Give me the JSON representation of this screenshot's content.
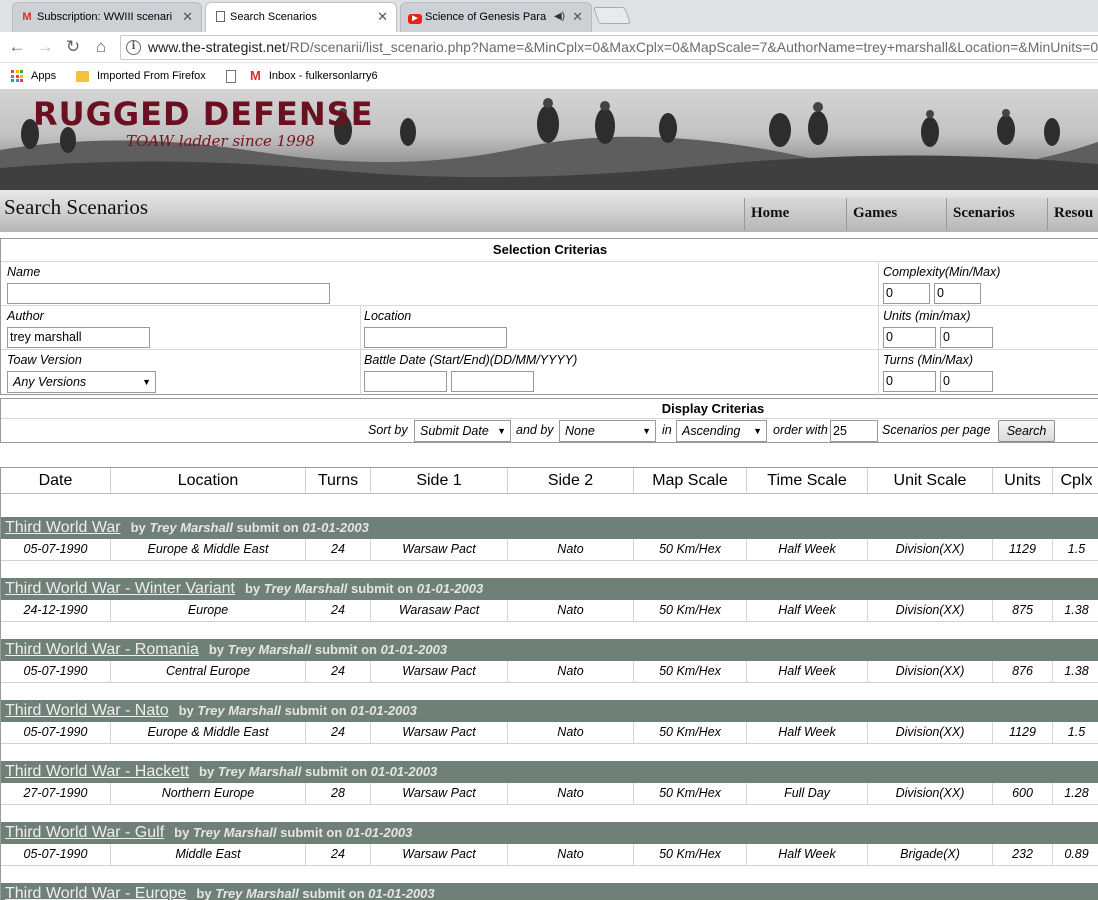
{
  "browser": {
    "tabs": [
      {
        "title": "Subscription: WWIII scenari",
        "icon": "gmail-icon"
      },
      {
        "title": "Search Scenarios",
        "icon": "page-icon"
      },
      {
        "title": "Science of Genesis Para",
        "icon": "youtube-icon"
      }
    ],
    "url_host": "www.the-strategist.net",
    "url_path": "/RD/scenarii/list_scenario.php?Name=&MinCplx=0&MaxCplx=0&MapScale=7&AuthorName=trey+marshall&Location=&MinUnits=0&M",
    "bookmarks": [
      "Apps",
      "Imported From Firefox",
      "Inbox - fulkersonlarry6"
    ]
  },
  "site": {
    "logo": "RUGGED DEFENSE",
    "tagline": "TOAW ladder since 1998",
    "page_title": "Search Scenarios",
    "menu": [
      "Home",
      "Games",
      "Scenarios",
      "Resou"
    ]
  },
  "selection": {
    "title": "Selection Criterias",
    "name_label": "Name",
    "name_value": "",
    "complexity_label": "Complexity(Min/Max)",
    "complexity_min": "0",
    "complexity_max": "0",
    "author_label": "Author",
    "author_value": "trey marshall",
    "location_label": "Location",
    "location_value": "",
    "units_label": "Units (min/max)",
    "units_min": "0",
    "units_max": "0",
    "version_label": "Toaw Version",
    "version_value": "Any Versions",
    "battle_date_label": "Battle Date (Start/End)(DD/MM/YYYY)",
    "battle_start": "",
    "battle_end": "",
    "turns_label": "Turns (Min/Max)",
    "turns_min": "0",
    "turns_max": "0"
  },
  "display": {
    "title": "Display Criterias",
    "sort_by_label": "Sort by",
    "sort_by_value": "Submit Date",
    "and_by_label": "and by",
    "and_by_value": "None",
    "in_label": "in",
    "order_value": "Ascending",
    "order_with_label": "order with",
    "per_page_value": "25",
    "per_page_label": "Scenarios per page",
    "search_button": "Search"
  },
  "table": {
    "columns": [
      "Date",
      "Location",
      "Turns",
      "Side 1",
      "Side 2",
      "Map Scale",
      "Time Scale",
      "Unit Scale",
      "Units",
      "Cplx"
    ],
    "by_label": "by",
    "submit_label": "submit on",
    "scenarios": [
      {
        "name": "Third World War",
        "author": "Trey Marshall",
        "submitted": "01-01-2003",
        "row": [
          "05-07-1990",
          "Europe & Middle East",
          "24",
          "Warsaw Pact",
          "Nato",
          "50 Km/Hex",
          "Half Week",
          "Division(XX)",
          "1129",
          "1.5"
        ]
      },
      {
        "name": "Third World War - Winter Variant",
        "author": "Trey Marshall",
        "submitted": "01-01-2003",
        "row": [
          "24-12-1990",
          "Europe",
          "24",
          "Warasaw Pact",
          "Nato",
          "50 Km/Hex",
          "Half Week",
          "Division(XX)",
          "875",
          "1.38"
        ]
      },
      {
        "name": "Third World War - Romania",
        "author": "Trey Marshall",
        "submitted": "01-01-2003",
        "row": [
          "05-07-1990",
          "Central Europe",
          "24",
          "Warsaw Pact",
          "Nato",
          "50 Km/Hex",
          "Half Week",
          "Division(XX)",
          "876",
          "1.38"
        ]
      },
      {
        "name": "Third World War - Nato",
        "author": "Trey Marshall",
        "submitted": "01-01-2003",
        "row": [
          "05-07-1990",
          "Europe & Middle East",
          "24",
          "Warsaw Pact",
          "Nato",
          "50 Km/Hex",
          "Half Week",
          "Division(XX)",
          "1129",
          "1.5"
        ]
      },
      {
        "name": "Third World War - Hackett",
        "author": "Trey Marshall",
        "submitted": "01-01-2003",
        "row": [
          "27-07-1990",
          "Northern Europe",
          "28",
          "Warsaw Pact",
          "Nato",
          "50 Km/Hex",
          "Full Day",
          "Division(XX)",
          "600",
          "1.28"
        ]
      },
      {
        "name": "Third World War - Gulf",
        "author": "Trey Marshall",
        "submitted": "01-01-2003",
        "row": [
          "05-07-1990",
          "Middle East",
          "24",
          "Warsaw Pact",
          "Nato",
          "50 Km/Hex",
          "Half Week",
          "Brigade(X)",
          "232",
          "0.89"
        ]
      },
      {
        "name": "Third World War - Europe",
        "author": "Trey Marshall",
        "submitted": "01-01-2003",
        "row": []
      }
    ]
  }
}
